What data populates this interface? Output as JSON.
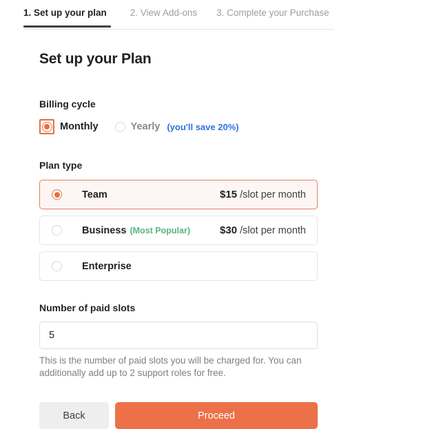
{
  "stepper": {
    "tabs": [
      {
        "label": "1. Set up your plan",
        "state": "active"
      },
      {
        "label": "2. View Add-ons",
        "state": "inactive"
      },
      {
        "label": "3. Complete your Purchase",
        "state": "inactive"
      }
    ]
  },
  "page": {
    "title": "Set up your Plan"
  },
  "billing_cycle": {
    "label": "Billing cycle",
    "options": [
      {
        "label": "Monthly",
        "selected": true
      },
      {
        "label": "Yearly",
        "selected": false
      }
    ],
    "save_note": "(you'll save 20%)"
  },
  "plan_type": {
    "label": "Plan type",
    "plans": [
      {
        "name": "Team",
        "tag": "",
        "price_amount": "$15",
        "price_unit": "/slot per month",
        "selected": true
      },
      {
        "name": "Business",
        "tag": "(Most Popular)",
        "price_amount": "$30",
        "price_unit": "/slot per month",
        "selected": false
      },
      {
        "name": "Enterprise",
        "tag": "",
        "price_amount": "",
        "price_unit": "",
        "selected": false
      }
    ]
  },
  "slots": {
    "label": "Number of paid slots",
    "value": "5",
    "placeholder": "",
    "help_text": "This is the number of paid slots you will be charged for. You can additionally add up to 2 support roles for free."
  },
  "actions": {
    "back_label": "Back",
    "proceed_label": "Proceed"
  },
  "colors": {
    "accent_orange": "#ec7148",
    "card_selected_border": "#e08060",
    "card_selected_bg": "#fdf6f4",
    "link_blue": "#2f72e0",
    "tag_green": "#57b67c",
    "text_primary": "#1f2124",
    "text_muted": "#7d8085",
    "back_button_bg": "#eeeeef"
  }
}
